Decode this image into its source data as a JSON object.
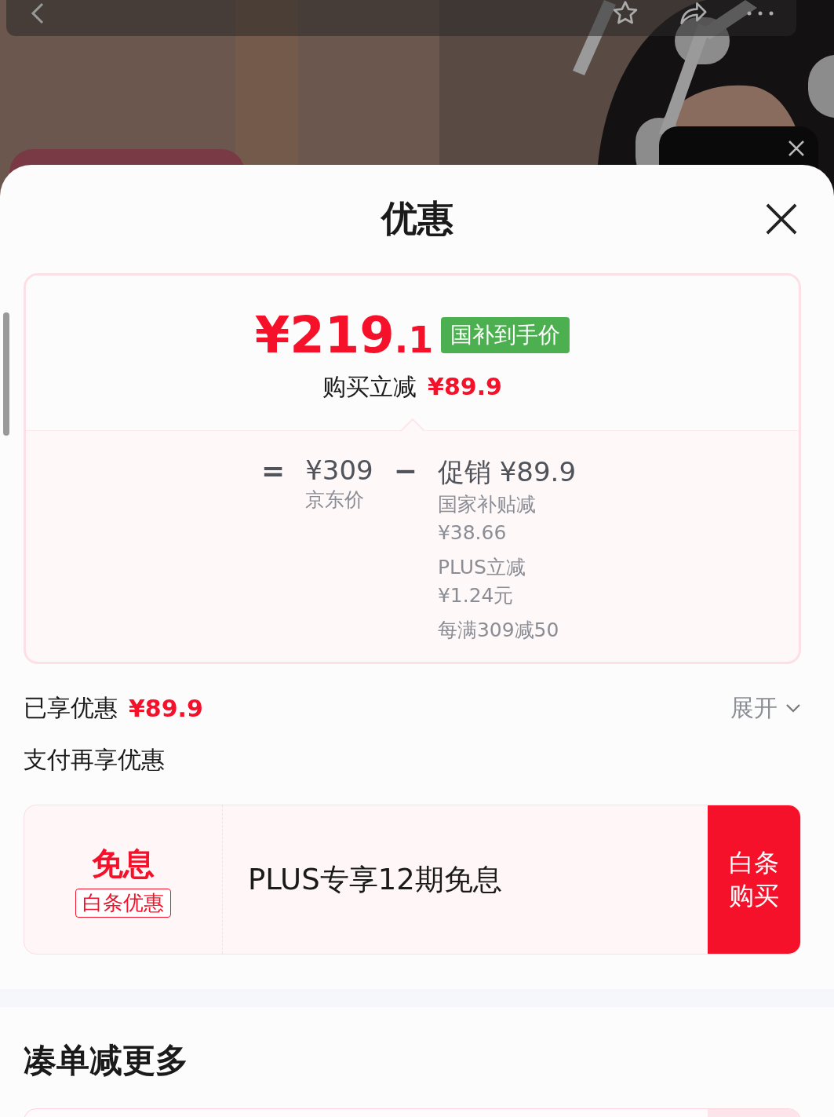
{
  "sheet": {
    "title": "优惠"
  },
  "price_card": {
    "final_price": "¥219",
    "final_decimal": ".1",
    "price_tag": "国补到手价",
    "discount_label": "购买立减",
    "discount_amount": "¥89.9",
    "breakdown": {
      "equals": "=",
      "base_price": "¥309",
      "base_label": "京东价",
      "minus": "−",
      "promo": "促销 ¥89.9",
      "promo_items": [
        {
          "label": "国家补贴减",
          "amount": "¥38.66"
        },
        {
          "label": "PLUS立减",
          "amount": "¥1.24元"
        },
        {
          "label": "每满309减50"
        }
      ]
    }
  },
  "savings": {
    "label": "已享优惠",
    "amount": "¥89.9",
    "expand": "展开",
    "expanded": false
  },
  "pay_section": {
    "title": "支付再享优惠",
    "offer": {
      "headline": "免息",
      "badge": "白条优惠",
      "description": "PLUS专享12期免息",
      "button": "白条购买"
    }
  },
  "bundle_section": {
    "title": "凑单减更多"
  }
}
